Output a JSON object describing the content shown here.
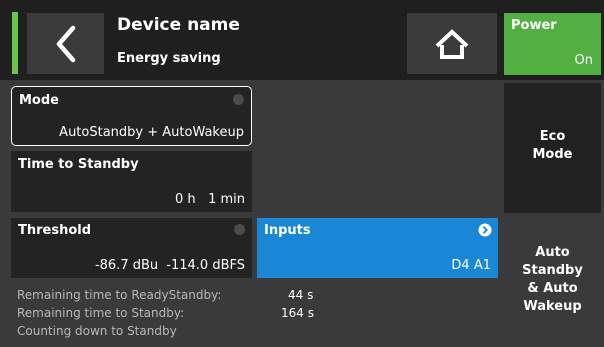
{
  "header": {
    "title": "Device name",
    "subtitle": "Energy saving"
  },
  "power": {
    "label": "Power",
    "state": "On"
  },
  "mode": {
    "label": "Mode",
    "value": "AutoStandby + AutoWakeup"
  },
  "time_to_standby": {
    "label": "Time to Standby",
    "value": "0 h   1 min"
  },
  "threshold": {
    "label": "Threshold",
    "value_dbu": "-86.7 dBu",
    "value_dbfs": "-114.0 dBFS"
  },
  "inputs": {
    "label": "Inputs",
    "value": "D4 A1"
  },
  "eco_mode": {
    "line1": "Eco",
    "line2": "Mode"
  },
  "auto_mode": {
    "line1": "Auto",
    "line2": "Standby",
    "line3": "& Auto",
    "line4": "Wakeup"
  },
  "status": {
    "ready_label": "Remaining time to ReadyStandby:",
    "ready_value": "44 s",
    "standby_label": "Remaining time to Standby:",
    "standby_value": "164 s",
    "counting": "Counting down to Standby"
  },
  "colors": {
    "accent_green": "#6cc24a",
    "power_green": "#52b043",
    "inputs_blue": "#1a86d6",
    "background": "#3a3a3a"
  },
  "icons": {
    "back": "chevron-left-icon",
    "home": "home-icon",
    "inputs_indicator": "chevron-right-circle-icon"
  }
}
